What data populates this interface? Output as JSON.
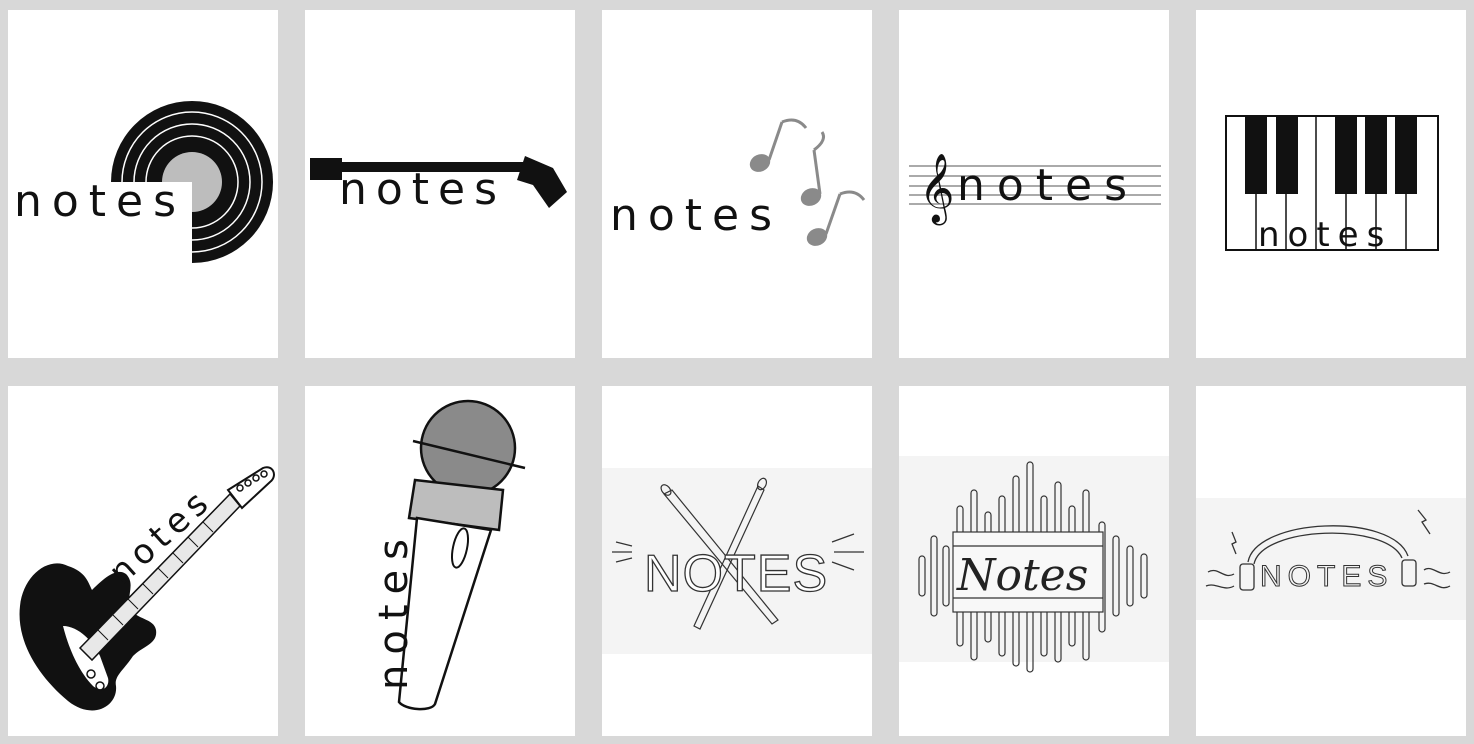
{
  "logos": [
    {
      "text": "notes",
      "icon": "vinyl-record-icon"
    },
    {
      "text": "notes",
      "icon": "record-needle-arm-icon"
    },
    {
      "text": "notes",
      "icon": "music-notes-icon"
    },
    {
      "text": "notes",
      "icon": "treble-clef-staff-icon"
    },
    {
      "text": "notes",
      "icon": "piano-keys-icon"
    },
    {
      "text": "notes",
      "icon": "electric-guitar-icon"
    },
    {
      "text": "notes",
      "icon": "microphone-icon"
    },
    {
      "text": "NOTES",
      "icon": "crossed-drumsticks-icon"
    },
    {
      "text": "Notes",
      "icon": "sound-wave-icon"
    },
    {
      "text": "NOTES",
      "icon": "headphones-icon"
    }
  ],
  "colors": {
    "background": "#d8d8d8",
    "card": "#ffffff",
    "ink": "#111111",
    "gray_fill": "#8a8a8a",
    "light_gray": "#bdbdbd"
  }
}
